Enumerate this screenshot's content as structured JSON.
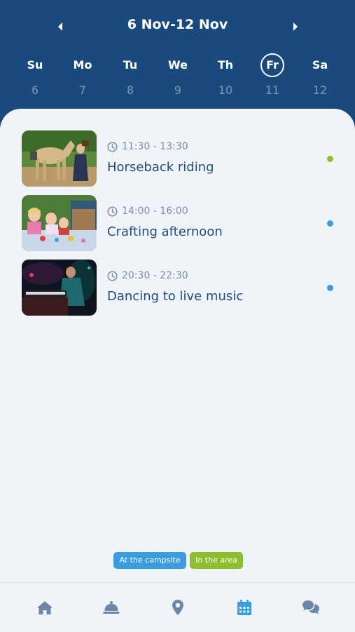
{
  "header": {
    "week_range": "6 Nov-12 Nov",
    "days": [
      {
        "name": "Su",
        "num": "6"
      },
      {
        "name": "Mo",
        "num": "7"
      },
      {
        "name": "Tu",
        "num": "8"
      },
      {
        "name": "We",
        "num": "9"
      },
      {
        "name": "Th",
        "num": "10"
      },
      {
        "name": "Fr",
        "num": "11",
        "selected": true
      },
      {
        "name": "Sa",
        "num": "12"
      }
    ]
  },
  "events": [
    {
      "time": "11:30 - 13:30",
      "title": "Horseback riding",
      "category": "In the area",
      "dot_color": "#8cbf2e",
      "image": "horse-photo"
    },
    {
      "time": "14:00 - 16:00",
      "title": "Crafting afternoon",
      "category": "At the campsite",
      "dot_color": "#3a9de0",
      "image": "crafting-photo"
    },
    {
      "time": "20:30 - 22:30",
      "title": "Dancing to live music",
      "category": "At the campsite",
      "dot_color": "#3a9de0",
      "image": "music-photo"
    }
  ],
  "legend": {
    "campsite": {
      "label": "At the campsite",
      "color": "#3a9de0"
    },
    "area": {
      "label": "In the area",
      "color": "#8cbf2e"
    }
  },
  "bottom_nav": {
    "items": [
      {
        "icon": "home-icon"
      },
      {
        "icon": "reception-bell-icon"
      },
      {
        "icon": "map-pin-icon"
      },
      {
        "icon": "calendar-icon",
        "active": true
      },
      {
        "icon": "chat-icon"
      }
    ]
  },
  "colors": {
    "brand": "#1a4a7c",
    "background": "#f0f4f8",
    "nav_icon": "#6a87a8",
    "nav_icon_active": "#3a9de0"
  }
}
